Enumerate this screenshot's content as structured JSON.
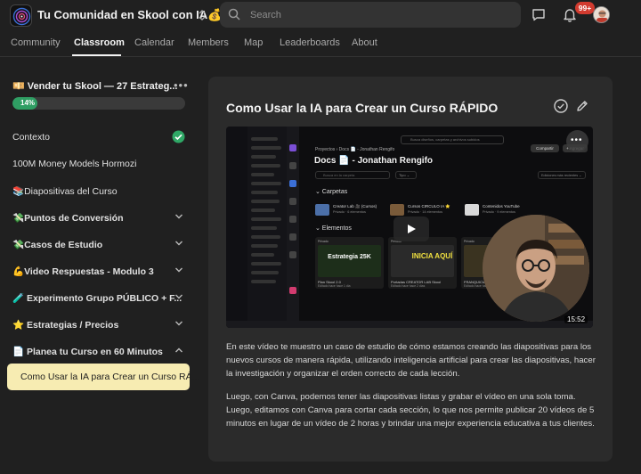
{
  "header": {
    "community_name": "Tu Comunidad en Skool con IA💰",
    "search_placeholder": "Search",
    "notifications_badge": "99+"
  },
  "tabs": [
    {
      "label": "Community",
      "active": false
    },
    {
      "label": "Classroom",
      "active": true
    },
    {
      "label": "Calendar",
      "active": false
    },
    {
      "label": "Members",
      "active": false
    },
    {
      "label": "Map",
      "active": false
    },
    {
      "label": "Leaderboards",
      "active": false
    },
    {
      "label": "About",
      "active": false
    }
  ],
  "sidebar": {
    "course_title": "💴 Vender tu Skool — 27 Estrateg...",
    "progress_label": "14%",
    "progress_value": 14,
    "items": [
      {
        "label": "Contexto",
        "bold": false,
        "completed": true
      },
      {
        "label": "100M Money Models Hormozi",
        "bold": false
      },
      {
        "label": "📚Diapositivas del Curso",
        "bold": false
      },
      {
        "label": "💸Puntos de Conversión",
        "bold": true,
        "expanded": false
      },
      {
        "label": "💸Casos de Estudio",
        "bold": true,
        "expanded": false
      },
      {
        "label": "💪Video Respuestas - Modulo 3",
        "bold": true,
        "expanded": false
      },
      {
        "label": "🧪 Experimento Grupo PÚBLICO + F...",
        "bold": true,
        "expanded": false
      },
      {
        "label": "⭐ Estrategias / Precios",
        "bold": true,
        "expanded": false
      },
      {
        "label": "📄 Planea tu Curso en 60 Minutos",
        "bold": true,
        "expanded": true
      }
    ],
    "active_lesson": "Como Usar la IA para Crear un Curso RÁ..."
  },
  "lesson": {
    "title": "Como Usar la IA para Crear un Curso RÁPIDO",
    "paragraphs": [
      "En este vídeo te muestro un caso de estudio de cómo estamos creando las diapositivas para los nuevos cursos de manera rápida, utilizando inteligencia artificial para crear las diapositivas, hacer la investigación y organizar el orden correcto de cada lección.",
      "Luego, con Canva, podemos tener las diapositivas listas y grabar el vídeo en una sola toma. Luego, editamos con Canva para cortar cada sección, lo que nos permite publicar 20 vídeos de 5 minutos en lugar de un vídeo de 2 horas y brindar una mejor experiencia educativa a tus clientes."
    ]
  },
  "video": {
    "duration": "15:52",
    "breadcrumb": "Proyectos  ›  Docs 📄 - Jonathan Rengifo",
    "search_text": "Busca diseños, carpetas y archivos subidos",
    "heading": "Docs 📄 - Jonathan Rengifo",
    "share_label": "Compartir",
    "add_label": "+ Agregar",
    "search_folder": "Busca en la carpeta",
    "type_label": "Tipo ⌄",
    "sort_label": "Ediciones más recientes ⌄",
    "section_folders": "⌄  Carpetas",
    "section_elements": "⌄  Elementos",
    "folders": [
      {
        "title": "Creator Lab 🎥 (Cursos)",
        "sub": "Privado · 6 elementos",
        "color": "#4b6fa8"
      },
      {
        "title": "Cursos CIRCULO IA ⭐",
        "sub": "Privado · 14 elementos",
        "color": "#7a5b3a"
      },
      {
        "title": "Contenidos YouTube",
        "sub": "Privado · 9 elementos",
        "color": "#3a3a3a"
      }
    ],
    "tiles": [
      {
        "tag": "Privado",
        "caption": "Plan Skool 2.0",
        "sub": "Editado hace hace 1 día",
        "art": "Estrategia 25K"
      },
      {
        "tag": "Privado",
        "caption": "Portadas CREATOR LAB Skool",
        "sub": "Editado hace hace 2 días",
        "art": "INICIA AQUÍ"
      },
      {
        "tag": "Privado",
        "caption": "FRANQUICIA IA Videos Revisi...",
        "sub": "Editado hace hace 3 días",
        "art": ""
      }
    ]
  },
  "colors": {
    "background": "#202020",
    "card": "#2b2b2b",
    "progress": "#2f9e63",
    "active_lesson_bg": "#f7ecb2",
    "badge": "#d23b2f"
  }
}
